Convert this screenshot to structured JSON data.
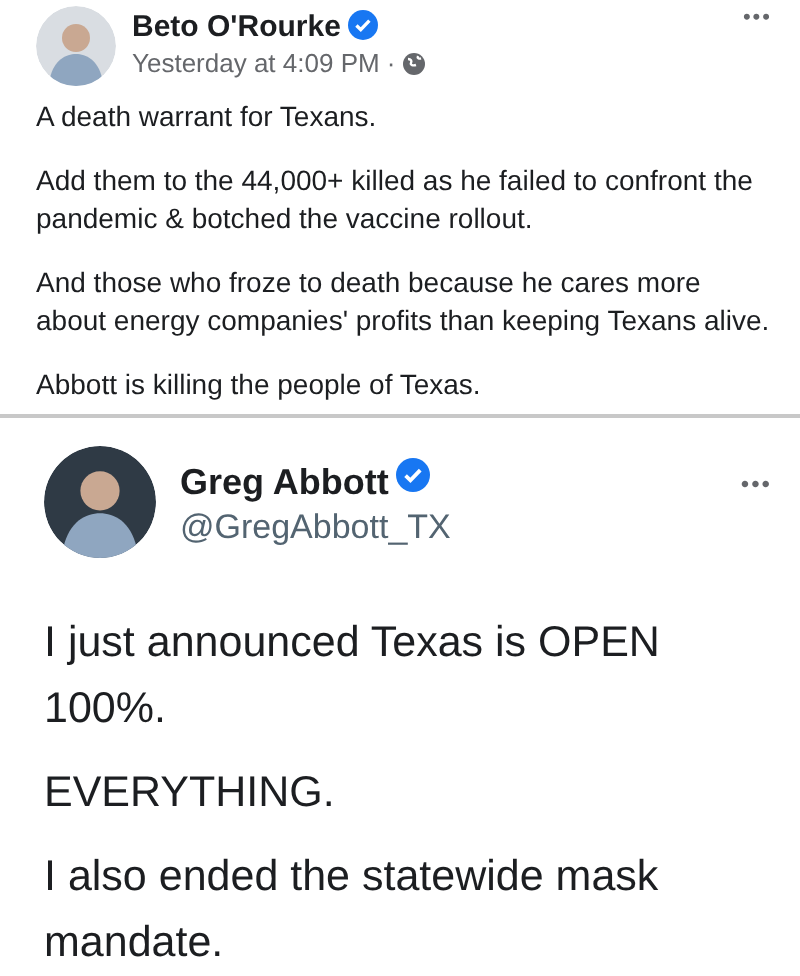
{
  "facebook_post": {
    "author": "Beto O'Rourke",
    "verified": true,
    "timestamp": "Yesterday at 4:09 PM ·",
    "more": "•••",
    "paragraphs": [
      "A death warrant for Texans.",
      "Add them to the 44,000+ killed as he failed to confront the pandemic & botched the vaccine rollout.",
      "And those who froze to death because he cares more about energy companies' profits than keeping Texans alive.",
      "Abbott is killing the people of Texas."
    ]
  },
  "tweet": {
    "author": "Greg Abbott",
    "verified": true,
    "handle": "@GregAbbott_TX",
    "more": "•••",
    "paragraphs": [
      "I just announced Texas is OPEN 100%.",
      "EVERYTHING.",
      "I also ended the statewide mask mandate."
    ]
  }
}
